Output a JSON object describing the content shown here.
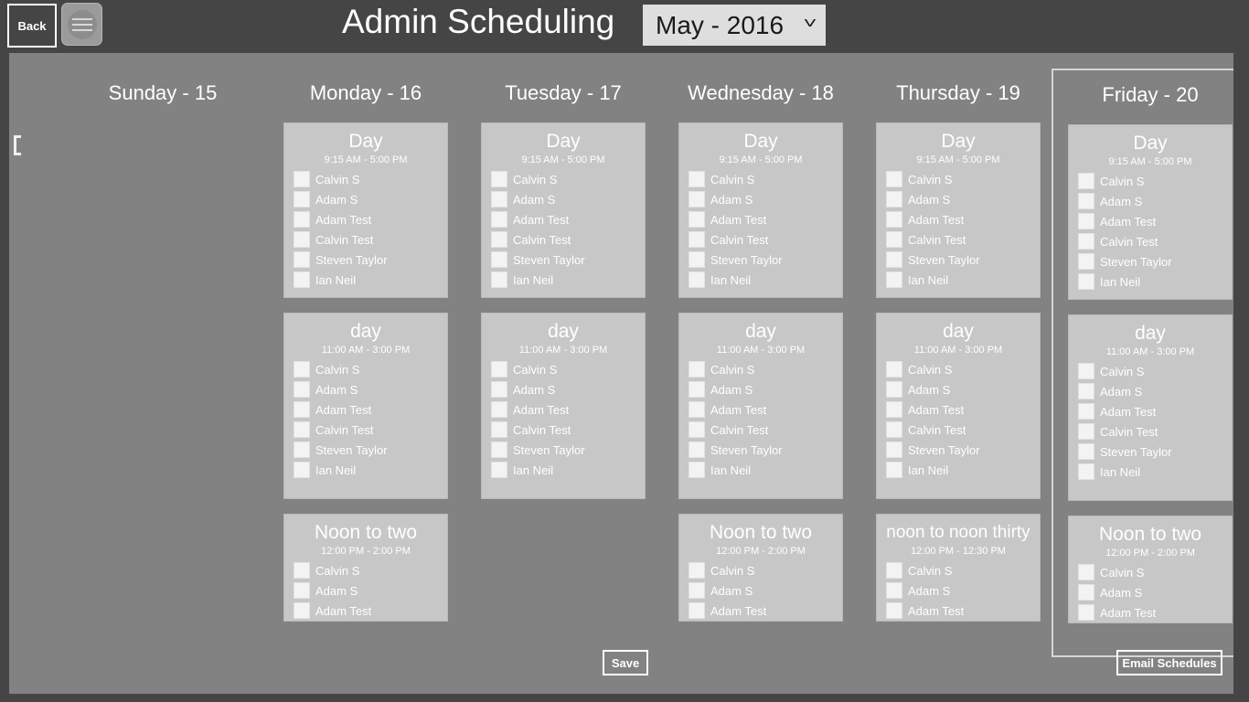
{
  "window": {
    "title": "Admin Scheduling"
  },
  "topbar": {
    "back_label": "Back",
    "menu_icon": "hamburger-menu-icon",
    "title": "Admin Scheduling",
    "month_select": {
      "value": "May - 2016",
      "chevron": "˅"
    }
  },
  "content": {
    "scroll_hint_icon": "scroll-left-indicator"
  },
  "columns": [
    {
      "header": "Sunday - 15",
      "selected": false,
      "cards": [
        null,
        null,
        null
      ]
    },
    {
      "header": "Monday - 16",
      "selected": false,
      "cards": [
        {
          "title": "Day",
          "time": "9:15 AM - 5:00 PM",
          "people": [
            "Calvin S",
            "Adam S",
            "Adam Test",
            "Calvin Test",
            "Steven Taylor",
            "Ian Neil"
          ]
        },
        {
          "title": "day",
          "time": "11:00 AM - 3:00 PM",
          "people": [
            "Calvin S",
            "Adam S",
            "Adam Test",
            "Calvin Test",
            "Steven Taylor",
            "Ian Neil"
          ]
        },
        {
          "title": "Noon to two",
          "time": "12:00 PM - 2:00 PM",
          "people": [
            "Calvin S",
            "Adam S",
            "Adam Test"
          ]
        }
      ]
    },
    {
      "header": "Tuesday - 17",
      "selected": false,
      "cards": [
        {
          "title": "Day",
          "time": "9:15 AM - 5:00 PM",
          "people": [
            "Calvin S",
            "Adam S",
            "Adam Test",
            "Calvin Test",
            "Steven Taylor",
            "Ian Neil"
          ]
        },
        {
          "title": "day",
          "time": "11:00 AM - 3:00 PM",
          "people": [
            "Calvin S",
            "Adam S",
            "Adam Test",
            "Calvin Test",
            "Steven Taylor",
            "Ian Neil"
          ]
        },
        null
      ]
    },
    {
      "header": "Wednesday - 18",
      "selected": false,
      "cards": [
        {
          "title": "Day",
          "time": "9:15 AM - 5:00 PM",
          "people": [
            "Calvin S",
            "Adam S",
            "Adam Test",
            "Calvin Test",
            "Steven Taylor",
            "Ian Neil"
          ]
        },
        {
          "title": "day",
          "time": "11:00 AM - 3:00 PM",
          "people": [
            "Calvin S",
            "Adam S",
            "Adam Test",
            "Calvin Test",
            "Steven Taylor",
            "Ian Neil"
          ]
        },
        {
          "title": "Noon to two",
          "time": "12:00 PM - 2:00 PM",
          "people": [
            "Calvin S",
            "Adam S",
            "Adam Test"
          ]
        }
      ]
    },
    {
      "header": "Thursday - 19",
      "selected": false,
      "cards": [
        {
          "title": "Day",
          "time": "9:15 AM - 5:00 PM",
          "people": [
            "Calvin S",
            "Adam S",
            "Adam Test",
            "Calvin Test",
            "Steven Taylor",
            "Ian Neil"
          ]
        },
        {
          "title": "day",
          "time": "11:00 AM - 3:00 PM",
          "people": [
            "Calvin S",
            "Adam S",
            "Adam Test",
            "Calvin Test",
            "Steven Taylor",
            "Ian Neil"
          ]
        },
        {
          "title": "noon to noon thirty",
          "time": "12:00 PM - 12:30 PM",
          "people": [
            "Calvin S",
            "Adam S",
            "Adam Test"
          ]
        }
      ]
    },
    {
      "header": "Friday - 20",
      "selected": true,
      "cards": [
        {
          "title": "Day",
          "time": "9:15 AM - 5:00 PM",
          "people": [
            "Calvin S",
            "Adam S",
            "Adam Test",
            "Calvin Test",
            "Steven Taylor",
            "Ian Neil"
          ]
        },
        {
          "title": "day",
          "time": "11:00 AM - 3:00 PM",
          "people": [
            "Calvin S",
            "Adam S",
            "Adam Test",
            "Calvin Test",
            "Steven Taylor",
            "Ian Neil"
          ]
        },
        {
          "title": "Noon to two",
          "time": "12:00 PM - 2:00 PM",
          "people": [
            "Calvin S",
            "Adam S",
            "Adam Test"
          ]
        }
      ]
    }
  ],
  "footer": {
    "save_label": "Save",
    "email_label": "Email Schedules"
  },
  "colors": {
    "chrome": "#454545",
    "content_bg": "#828282",
    "card_bg": "#c7c7c7",
    "text_light": "#ffffff",
    "dropdown_bg": "#dedede",
    "checkbox_bg": "#f3f3f3",
    "selected_border": "#d5d5d5"
  }
}
